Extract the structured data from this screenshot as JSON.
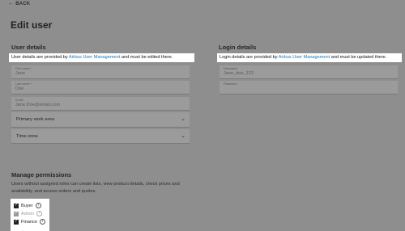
{
  "nav": {
    "back_label": "BACK"
  },
  "page": {
    "title": "Edit user"
  },
  "user_details": {
    "heading": "User details",
    "notice": {
      "pre": "User details are provided by ",
      "link": "Airbus User Management",
      "post": " and must be edited there."
    },
    "first_name": {
      "label": "First name *",
      "value": "Jane"
    },
    "last_name": {
      "label": "Last name *",
      "value": "Doe"
    },
    "email": {
      "label": "Email",
      "value": "Jane.Doe@email.com"
    },
    "primary_work_area": {
      "label": "Primary work area"
    },
    "time_zone": {
      "label": "Time zone"
    }
  },
  "login_details": {
    "heading": "Login details",
    "notice": {
      "pre": "Login details are provided by ",
      "link": "Airbus User Management",
      "post": " and must be updated there."
    },
    "username": {
      "label": "Username",
      "value": "Jane_doe_123"
    },
    "password": {
      "label": "Password"
    }
  },
  "permissions": {
    "heading": "Manage permissions",
    "description": "Users without assigned roles can create lists, view product details, check prices and availability, and access orders and quotes.",
    "roles": [
      {
        "label": "Buyer",
        "checked": true,
        "disabled": false
      },
      {
        "label": "Admin",
        "checked": true,
        "disabled": true
      },
      {
        "label": "Finance",
        "checked": true,
        "disabled": false
      }
    ]
  },
  "icons": {
    "back": "arrow-left-icon",
    "dropdown": "chevron-down-icon",
    "info": "info-icon",
    "check": "checkmark-icon"
  },
  "colors": {
    "overlay_background": "#8e8e8e",
    "link": "#1479b8",
    "highlight": "#ffffff"
  }
}
